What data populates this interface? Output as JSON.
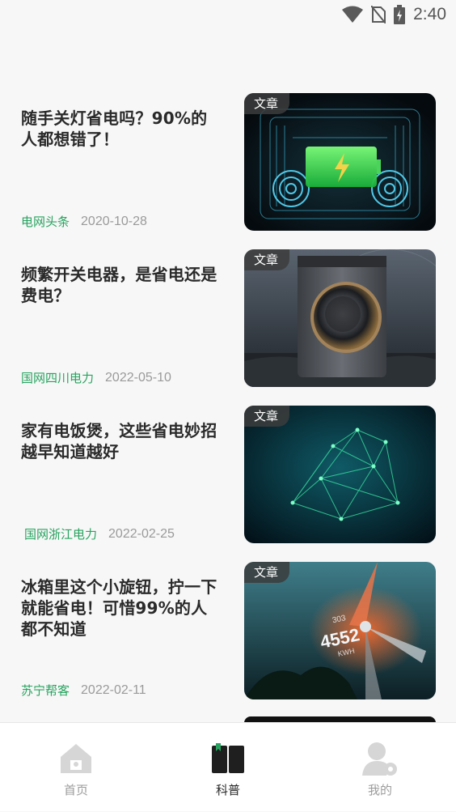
{
  "status_bar": {
    "time": "2:40",
    "icons": [
      "wifi-icon",
      "no-sim-icon",
      "battery-charging-icon"
    ]
  },
  "articles": [
    {
      "title": "随手关灯省电吗？90%的人都想错了！",
      "source": "电网头条",
      "date": "2020-10-28",
      "tag": "文章",
      "thumbnail": "battery-circuit-image"
    },
    {
      "title": "频繁开关电器，是省电还是费电？",
      "source": "国网四川电力",
      "date": "2022-05-10",
      "tag": "文章",
      "thumbnail": "washing-machine-image"
    },
    {
      "title": "家有电饭煲，这些省电妙招越早知道越好",
      "source": "国网浙江电力",
      "date": "2022-02-25",
      "tag": "文章",
      "thumbnail": "network-mesh-image"
    },
    {
      "title": "冰箱里这个小旋钮，拧一下就能省电！可惜99%的人都不知道",
      "source": "苏宁帮客",
      "date": "2022-02-11",
      "tag": "文章",
      "thumbnail": "wind-turbine-image"
    }
  ],
  "thumb_overlay": {
    "kwh_value": "4552",
    "kwh_unit": "KWH",
    "small_value": "303"
  },
  "tabbar": {
    "tabs": [
      {
        "label": "首页",
        "icon": "home-icon",
        "active": false
      },
      {
        "label": "科普",
        "icon": "book-icon",
        "active": true
      },
      {
        "label": "我的",
        "icon": "profile-icon",
        "active": false
      }
    ]
  },
  "colors": {
    "accent_green": "#27a35f",
    "title_text": "#2a2a2a",
    "meta_gray": "#9a9a9a",
    "background": "#f7f7f7"
  }
}
